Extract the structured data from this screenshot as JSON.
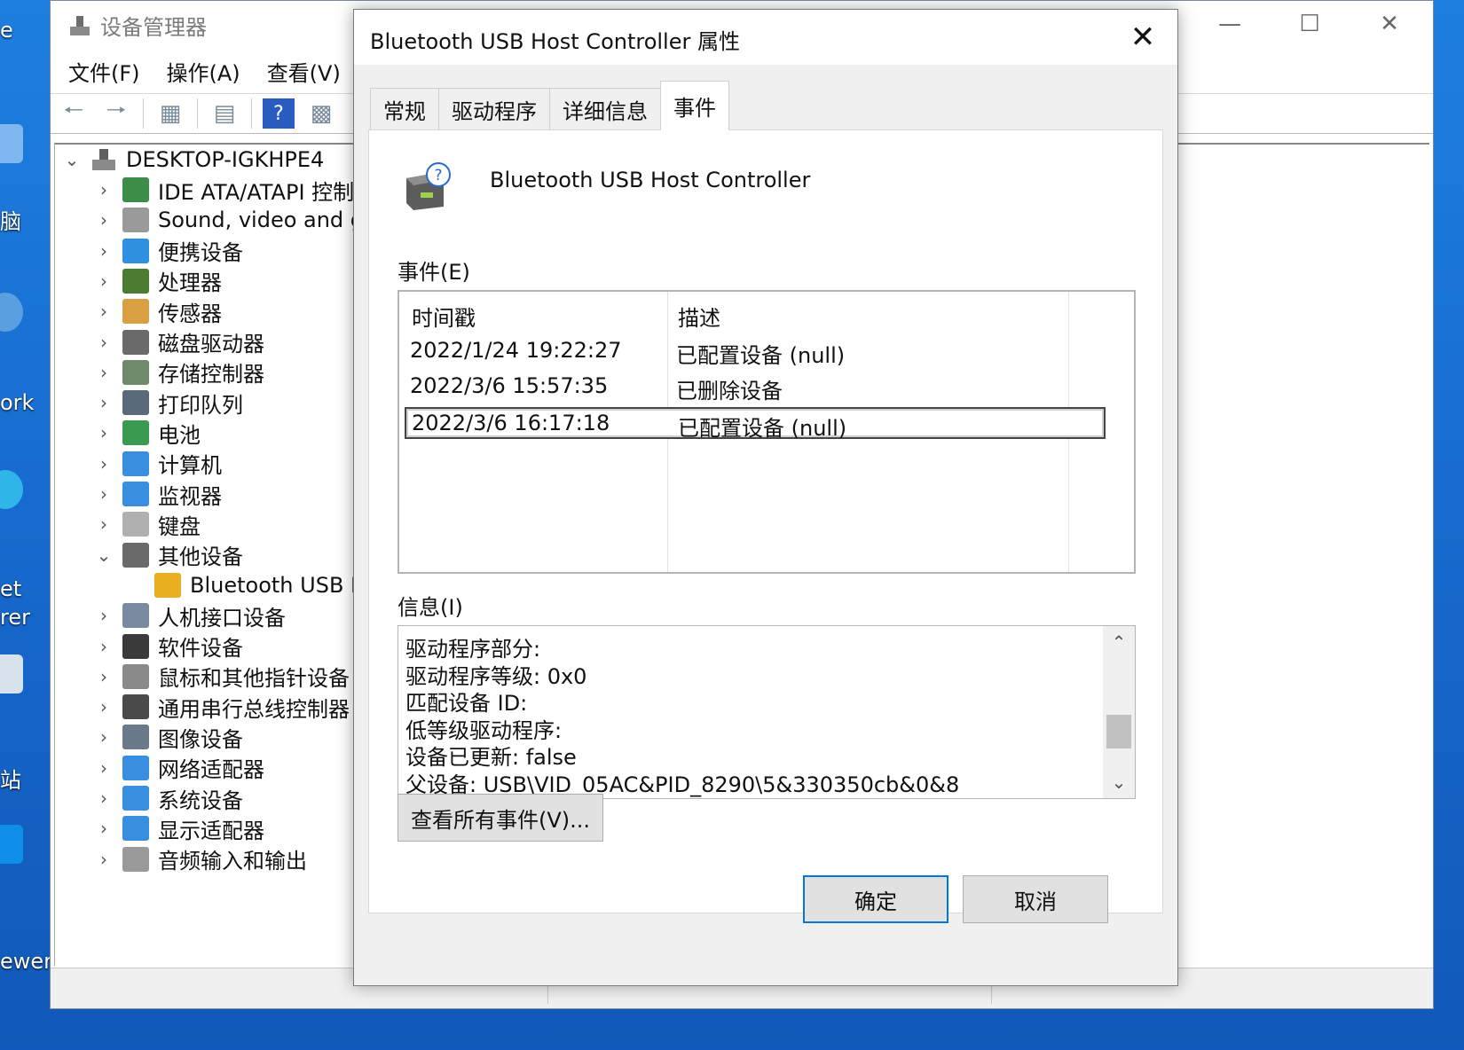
{
  "desktop": {
    "labels": [
      "e",
      "脑",
      "ork",
      "et",
      "rer",
      "站",
      "ewer"
    ]
  },
  "dm": {
    "title": "设备管理器",
    "menu": [
      "文件(F)",
      "操作(A)",
      "查看(V)"
    ],
    "tree_root": "DESKTOP-IGKHPE4",
    "tree_items": [
      {
        "label": "IDE ATA/ATAPI 控制",
        "icon": "ide-icon",
        "expanded": false
      },
      {
        "label": "Sound, video and ga",
        "icon": "speaker-icon",
        "expanded": false
      },
      {
        "label": "便携设备",
        "icon": "portable-device-icon",
        "expanded": false
      },
      {
        "label": "处理器",
        "icon": "processor-icon",
        "expanded": false
      },
      {
        "label": "传感器",
        "icon": "sensor-icon",
        "expanded": false
      },
      {
        "label": "磁盘驱动器",
        "icon": "disk-drive-icon",
        "expanded": false
      },
      {
        "label": "存储控制器",
        "icon": "storage-controller-icon",
        "expanded": false
      },
      {
        "label": "打印队列",
        "icon": "printer-icon",
        "expanded": false
      },
      {
        "label": "电池",
        "icon": "battery-icon",
        "expanded": false
      },
      {
        "label": "计算机",
        "icon": "computer-icon",
        "expanded": false
      },
      {
        "label": "监视器",
        "icon": "monitor-icon",
        "expanded": false
      },
      {
        "label": "键盘",
        "icon": "keyboard-icon",
        "expanded": false
      },
      {
        "label": "其他设备",
        "icon": "other-devices-icon",
        "expanded": true
      },
      {
        "label": "Bluetooth USB H",
        "icon": "warning-device-icon",
        "child": true
      },
      {
        "label": "人机接口设备",
        "icon": "hid-icon",
        "expanded": false
      },
      {
        "label": "软件设备",
        "icon": "software-device-icon",
        "expanded": false
      },
      {
        "label": "鼠标和其他指针设备",
        "icon": "mouse-icon",
        "expanded": false
      },
      {
        "label": "通用串行总线控制器",
        "icon": "usb-icon",
        "expanded": false
      },
      {
        "label": "图像设备",
        "icon": "camera-icon",
        "expanded": false
      },
      {
        "label": "网络适配器",
        "icon": "network-adapter-icon",
        "expanded": false
      },
      {
        "label": "系统设备",
        "icon": "system-device-icon",
        "expanded": false
      },
      {
        "label": "显示适配器",
        "icon": "display-adapter-icon",
        "expanded": false
      },
      {
        "label": "音频输入和输出",
        "icon": "audio-io-icon",
        "expanded": false
      }
    ]
  },
  "dialog": {
    "title": "Bluetooth USB Host Controller 属性",
    "tabs": [
      "常规",
      "驱动程序",
      "详细信息",
      "事件"
    ],
    "active_tab": "事件",
    "device_name": "Bluetooth USB Host Controller",
    "events_label": "事件(E)",
    "columns": [
      "时间戳",
      "描述"
    ],
    "events": [
      {
        "timestamp": "2022/1/24 19:22:27",
        "description": "已配置设备 (null)"
      },
      {
        "timestamp": "2022/3/6 15:57:35",
        "description": "已删除设备"
      },
      {
        "timestamp": "2022/3/6 16:17:18",
        "description": "已配置设备 (null)",
        "selected": true
      }
    ],
    "info_label": "信息(I)",
    "info_lines": [
      "驱动程序部分:",
      "驱动程序等级: 0x0",
      "匹配设备 ID:",
      "低等级驱动程序:",
      "设备已更新: false",
      "父设备: USB\\VID_05AC&PID_8290\\5&330350cb&0&8"
    ],
    "view_all_button": "查看所有事件(V)...",
    "ok_button": "确定",
    "cancel_button": "取消"
  }
}
